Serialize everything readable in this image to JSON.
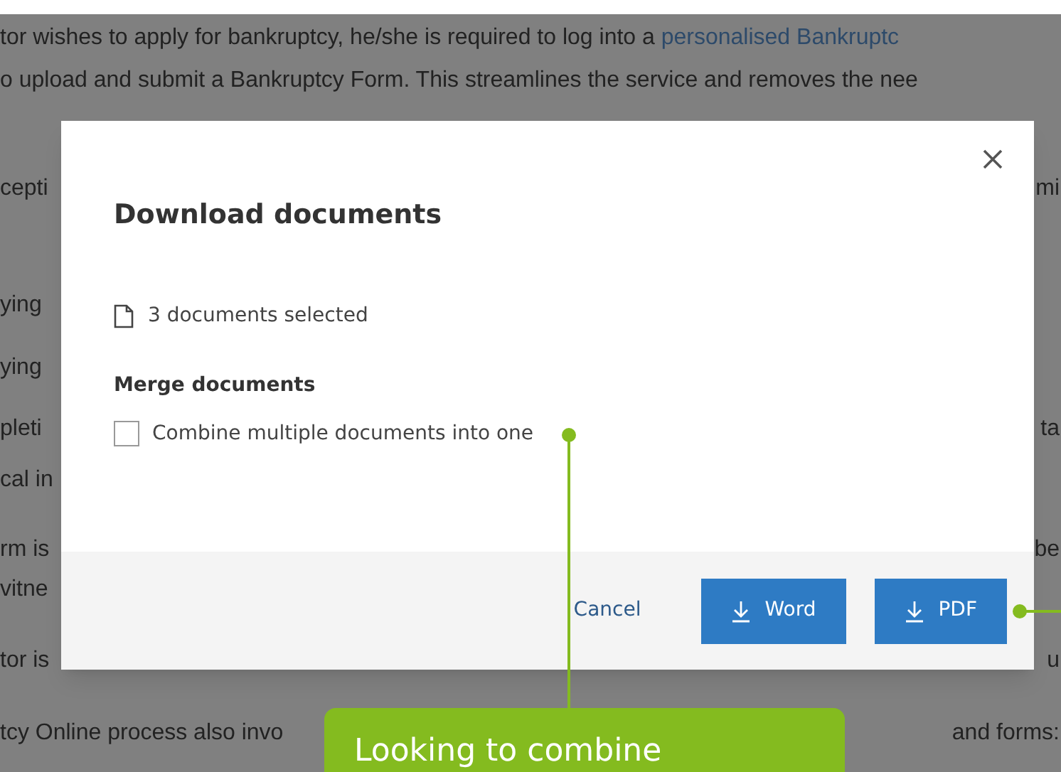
{
  "background": {
    "lines": [
      {
        "left": "tor wishes to apply for bankruptcy, he/she is required to log into a ",
        "link": "personalised Bankruptc"
      },
      {
        "left": "o upload and submit a Bankruptcy Form. This streamlines the service and removes the nee"
      },
      {
        "left": "cepti",
        "right": "mi"
      },
      {
        "left": "ying"
      },
      {
        "left": "ying"
      },
      {
        "left": "pleti",
        "right": "ta"
      },
      {
        "left": "cal in"
      },
      {
        "left": "rm is",
        "right": "be"
      },
      {
        "left": "vitne"
      },
      {
        "left": "tor is",
        "right": "u"
      },
      {
        "left": "tcy Online process also invo",
        "right": "and forms:"
      }
    ]
  },
  "dialog": {
    "title": "Download documents",
    "selection": "3 documents selected",
    "merge_heading": "Merge documents",
    "checkbox": {
      "label": "Combine multiple documents into one",
      "checked": false
    },
    "buttons": [
      {
        "kind": "link",
        "label": "Cancel"
      },
      {
        "kind": "download",
        "label": "Word"
      },
      {
        "kind": "download",
        "label": "PDF"
      }
    ]
  },
  "callout": {
    "text": "Looking to combine"
  }
}
